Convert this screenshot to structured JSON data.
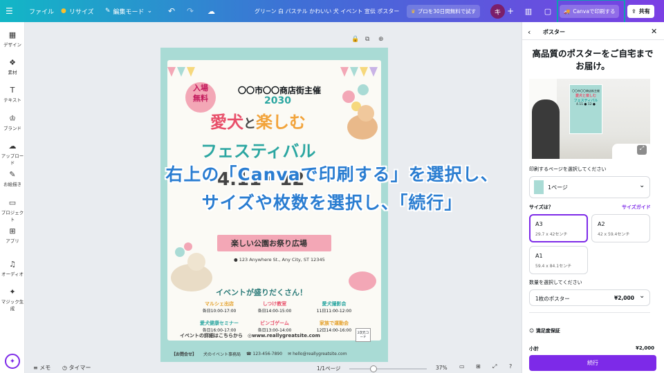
{
  "topbar": {
    "file": "ファイル",
    "resize": "リサイズ",
    "edit_mode": "編集モード",
    "doc_title": "グリーン 白 パステル かわいい 犬 イベント 宣伝 ポスター",
    "pro_trial": "プロを30日間無料で試す",
    "avatar_letter": "キ",
    "print_button": "Canvaで印刷する",
    "share": "共有"
  },
  "sidebar": [
    {
      "label": "デザイン",
      "icon": "layout-icon"
    },
    {
      "label": "素材",
      "icon": "elements-icon"
    },
    {
      "label": "テキスト",
      "icon": "text-icon"
    },
    {
      "label": "ブランド",
      "icon": "brand-icon"
    },
    {
      "label": "アップロード",
      "icon": "upload-icon"
    },
    {
      "label": "お絵描き",
      "icon": "draw-icon"
    },
    {
      "label": "プロジェクト",
      "icon": "folder-icon"
    },
    {
      "label": "アプリ",
      "icon": "apps-icon"
    },
    {
      "label": "オーディオ",
      "icon": "audio-icon"
    },
    {
      "label": "マジック生成",
      "icon": "magic-icon"
    }
  ],
  "poster": {
    "badge_top": "入場",
    "badge_bottom": "無料",
    "organizer": "〇〇市〇〇商店街主催",
    "year": "2030",
    "title_a": "愛犬",
    "title_b": "と",
    "title_c": "楽しむ",
    "title2": "フェスティバル",
    "date": "4.11・12",
    "venue": "楽しい公園お祭り広場",
    "address": "123 Anywhere St., Any City, ST 12345",
    "events_heading": "イベントが盛りだくさん！",
    "events": [
      {
        "name": "マルシェ出店",
        "time": "各日10:00-17:00",
        "color": "#e4a02a"
      },
      {
        "name": "しつけ教室",
        "time": "各日14:00-15:00",
        "color": "#e84f6a"
      },
      {
        "name": "愛犬撮影会",
        "time": "11日11:00-12:00",
        "color": "#2ba6a1"
      },
      {
        "name": "愛犬健康セミナー",
        "time": "各日16:00-17:00",
        "color": "#2ba6a1"
      },
      {
        "name": "ビンゴゲーム",
        "time": "各日13:00-14:00",
        "color": "#e84f6a"
      },
      {
        "name": "家族で運動会",
        "time": "12日14:00-16:00",
        "color": "#e4a02a"
      }
    ],
    "details": "イベントの詳細はこちらから",
    "website": "www.reallygreatsite.com",
    "qr": "2次元コード",
    "contact_label": "【お問合せ】",
    "contact_org": "犬のイベント事務局",
    "phone": "123-456-7890",
    "email": "hello@reallygreatsite.com"
  },
  "overlay": {
    "line1": "右上の「Canvaで印刷する」を選択し、",
    "line2": "サイズや枚数を選択し、「続行」"
  },
  "bottombar": {
    "notes": "メモ",
    "timer": "タイマー",
    "pages": "1/1ページ",
    "zoom": "37%"
  },
  "panel": {
    "tab": "ポスター",
    "headline": "高品質のポスターをご自宅までお届け。",
    "preview_lines": [
      "〇〇市〇〇商店街主催",
      "愛犬と楽しむ",
      "フェスティバル",
      "4.11 ● 12 ●"
    ],
    "page_select_label": "印刷するページを選択してください",
    "page_select_value": "1ページ",
    "size_label": "サイズは？",
    "size_guide": "サイズガイド",
    "sizes": [
      {
        "name": "A3",
        "dims": "29.7 x 42センチ",
        "selected": true
      },
      {
        "name": "A2",
        "dims": "42 x 59.4センチ",
        "selected": false
      },
      {
        "name": "A1",
        "dims": "59.4 x 84.1センチ",
        "selected": false
      }
    ],
    "qty_label": "数量を選択してください",
    "qty_value": "1枚のポスター",
    "qty_price": "¥2,000",
    "guarantee": "満足度保証",
    "subtotal_label": "小計",
    "subtotal_value": "¥2,000",
    "continue": "続行"
  },
  "colors": {
    "accent": "#7d2ae8",
    "print_highlight": "#0e9fb0",
    "poster_teal": "#a9dbd5",
    "pink": "#f3a7b6",
    "title_orange": "#f2a33a"
  }
}
